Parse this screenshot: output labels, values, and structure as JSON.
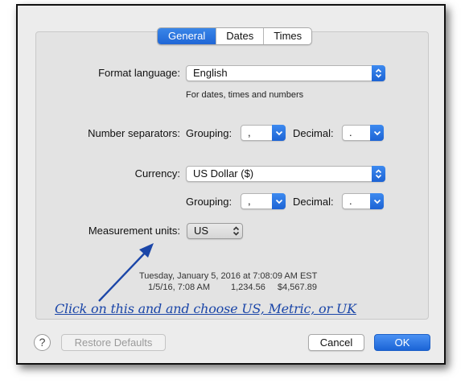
{
  "tabs": [
    {
      "label": "General",
      "active": true
    },
    {
      "label": "Dates",
      "active": false
    },
    {
      "label": "Times",
      "active": false
    }
  ],
  "format_language": {
    "label": "Format language:",
    "value": "English",
    "hint": "For dates, times and numbers"
  },
  "number_separators": {
    "label": "Number separators:",
    "grouping_label": "Grouping:",
    "grouping_value": ",",
    "decimal_label": "Decimal:",
    "decimal_value": "."
  },
  "currency": {
    "label": "Currency:",
    "value": "US Dollar ($)",
    "grouping_label": "Grouping:",
    "grouping_value": ",",
    "decimal_label": "Decimal:",
    "decimal_value": "."
  },
  "measurement": {
    "label": "Measurement units:",
    "value": "US"
  },
  "preview": {
    "line1": "Tuesday, January 5, 2016 at 7:08:09 AM EST",
    "date_short": "1/5/16, 7:08 AM",
    "number": "1,234.56",
    "currency": "$4,567.89"
  },
  "annotation": "Click on this and and choose US, Metric, or UK",
  "buttons": {
    "help": "?",
    "restore": "Restore Defaults",
    "cancel": "Cancel",
    "ok": "OK"
  },
  "colors": {
    "accent": "#1f66d6",
    "annotation": "#1b46a8"
  }
}
